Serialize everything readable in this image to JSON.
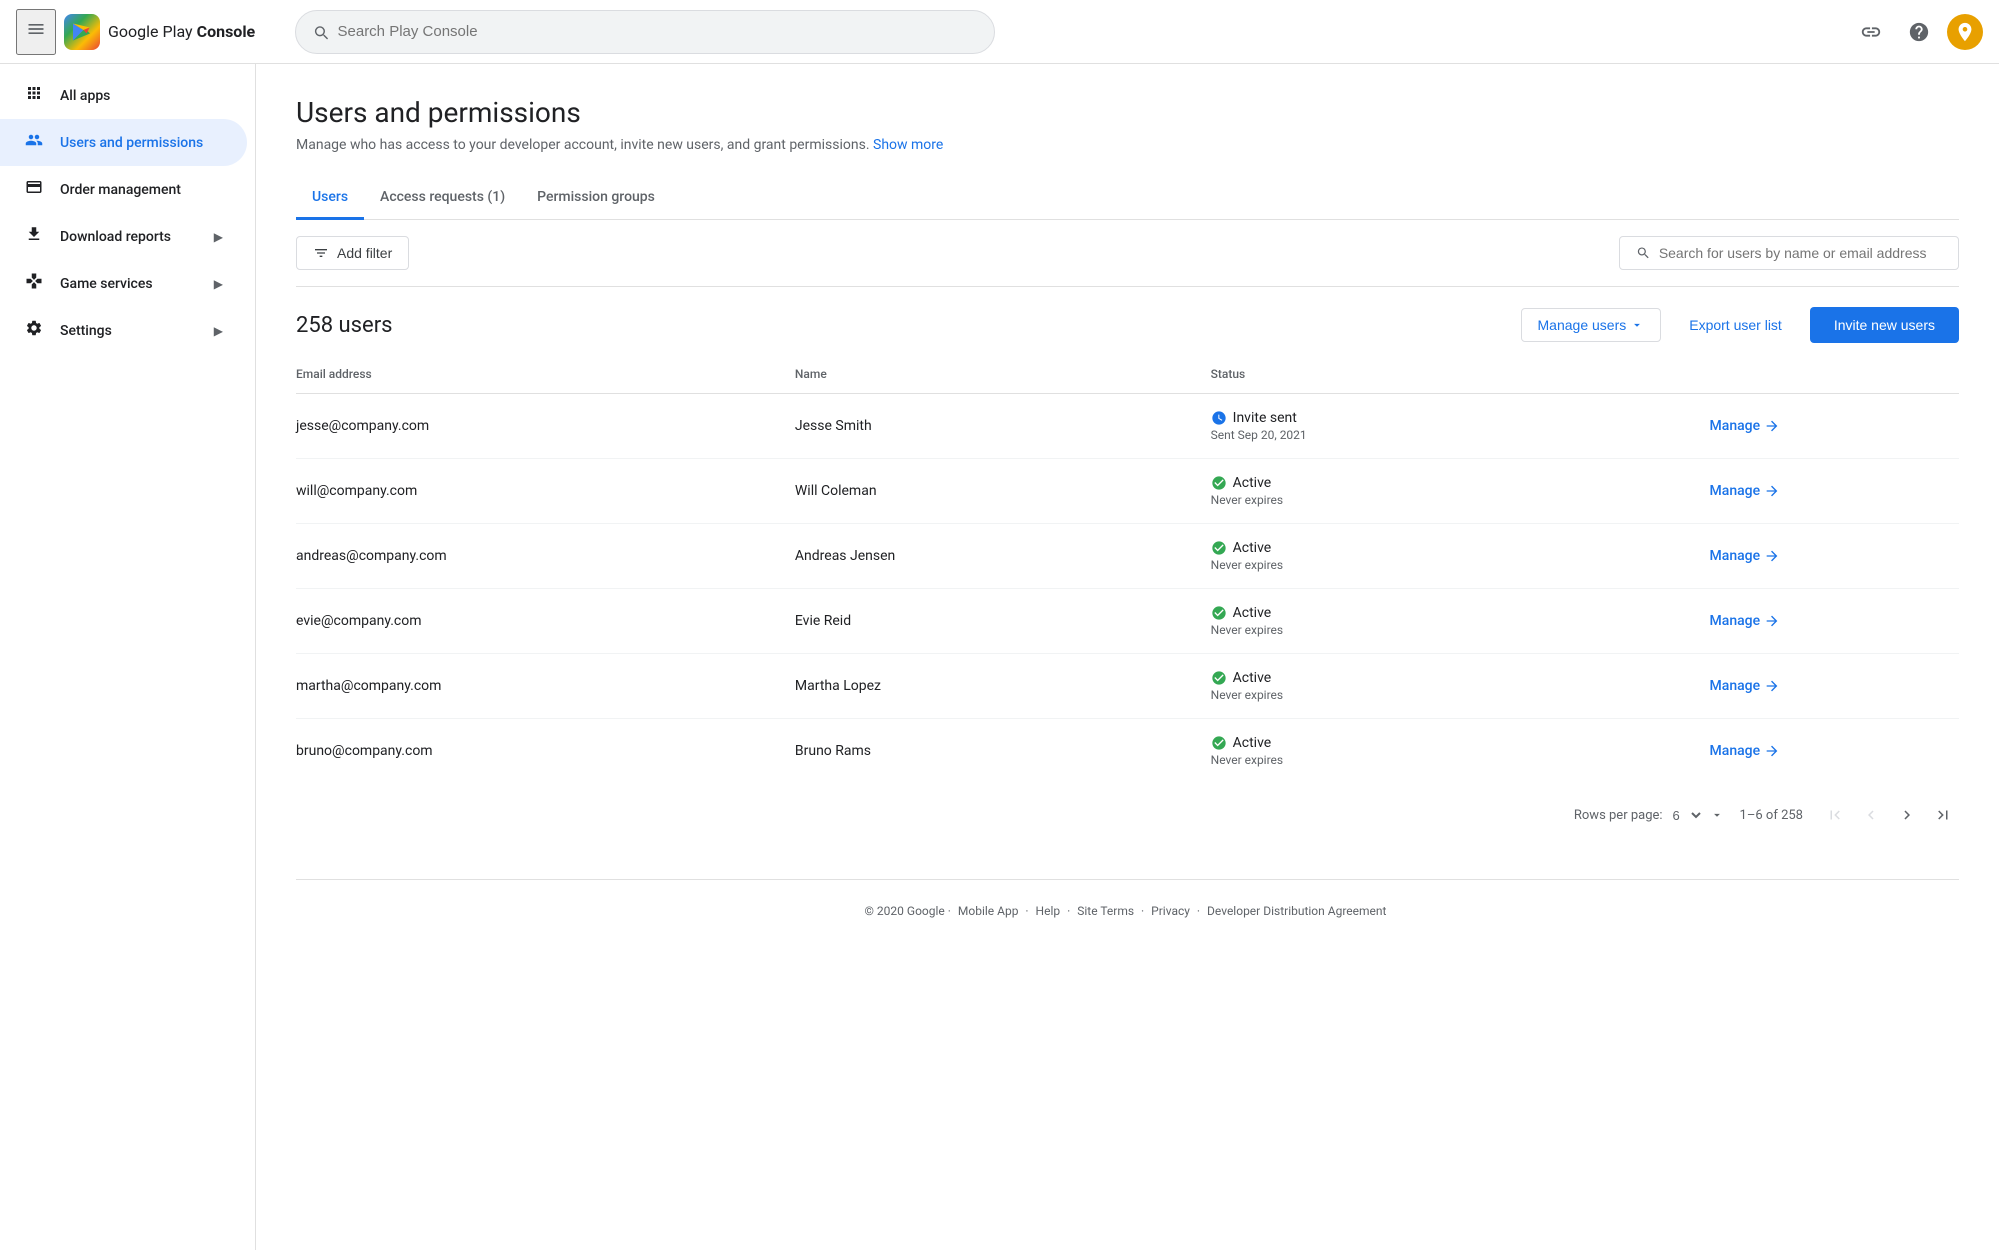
{
  "topbar": {
    "menu_icon": "☰",
    "logo_text_plain": "Google Play ",
    "logo_text_bold": "Console",
    "search_placeholder": "Search Play Console",
    "link_icon": "🔗",
    "help_icon": "?",
    "avatar_letter": "🦡"
  },
  "sidebar": {
    "items": [
      {
        "id": "all-apps",
        "label": "All apps",
        "icon": "⊞",
        "expandable": false
      },
      {
        "id": "users-permissions",
        "label": "Users and permissions",
        "icon": "👤",
        "expandable": false,
        "active": true
      },
      {
        "id": "order-management",
        "label": "Order management",
        "icon": "💳",
        "expandable": false
      },
      {
        "id": "download-reports",
        "label": "Download reports",
        "icon": "⬇",
        "expandable": true
      },
      {
        "id": "game-services",
        "label": "Game services",
        "icon": "🎮",
        "expandable": true
      },
      {
        "id": "settings",
        "label": "Settings",
        "icon": "⚙",
        "expandable": true
      }
    ]
  },
  "page": {
    "title": "Users and permissions",
    "subtitle": "Manage who has access to your developer account, invite new users, and grant permissions.",
    "show_more_label": "Show more"
  },
  "tabs": [
    {
      "id": "users",
      "label": "Users",
      "active": true
    },
    {
      "id": "access-requests",
      "label": "Access requests (1)",
      "active": false
    },
    {
      "id": "permission-groups",
      "label": "Permission groups",
      "active": false
    }
  ],
  "toolbar": {
    "filter_label": "Add filter",
    "search_placeholder": "Search for users by name or email address"
  },
  "users_section": {
    "count_label": "258 users",
    "manage_users_label": "Manage users",
    "export_label": "Export user list",
    "invite_label": "Invite new users"
  },
  "table": {
    "columns": [
      {
        "id": "email",
        "label": "Email address"
      },
      {
        "id": "name",
        "label": "Name"
      },
      {
        "id": "status",
        "label": "Status"
      },
      {
        "id": "action",
        "label": ""
      }
    ],
    "rows": [
      {
        "email": "jesse@company.com",
        "name": "Jesse Smith",
        "status_label": "Invite sent",
        "status_sub": "Sent Sep 20, 2021",
        "status_type": "pending",
        "action_label": "Manage"
      },
      {
        "email": "will@company.com",
        "name": "Will Coleman",
        "status_label": "Active",
        "status_sub": "Never expires",
        "status_type": "active",
        "action_label": "Manage"
      },
      {
        "email": "andreas@company.com",
        "name": "Andreas Jensen",
        "status_label": "Active",
        "status_sub": "Never expires",
        "status_type": "active",
        "action_label": "Manage"
      },
      {
        "email": "evie@company.com",
        "name": "Evie Reid",
        "status_label": "Active",
        "status_sub": "Never expires",
        "status_type": "active",
        "action_label": "Manage"
      },
      {
        "email": "martha@company.com",
        "name": "Martha Lopez",
        "status_label": "Active",
        "status_sub": "Never expires",
        "status_type": "active",
        "action_label": "Manage"
      },
      {
        "email": "bruno@company.com",
        "name": "Bruno Rams",
        "status_label": "Active",
        "status_sub": "Never expires",
        "status_type": "active",
        "action_label": "Manage"
      }
    ]
  },
  "pagination": {
    "rows_per_page_label": "Rows per page:",
    "rows_per_page_value": "6",
    "page_info": "1–6 of 258"
  },
  "footer": {
    "copyright": "© 2020 Google",
    "links": [
      "Mobile App",
      "Help",
      "Site Terms",
      "Privacy",
      "Developer Distribution Agreement"
    ]
  }
}
